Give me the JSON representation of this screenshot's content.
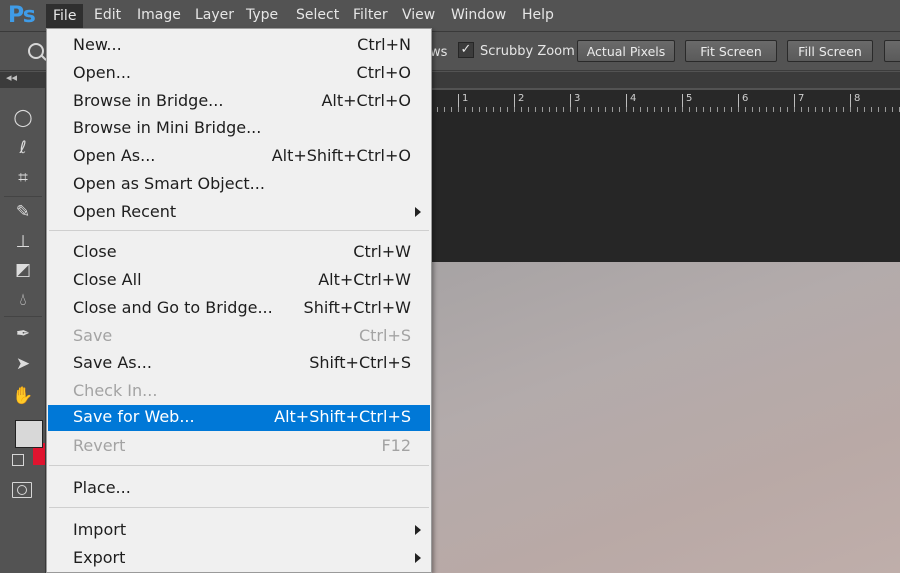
{
  "app_logo": "Ps",
  "menubar": [
    "File",
    "Edit",
    "Image",
    "Layer",
    "Type",
    "Select",
    "Filter",
    "View",
    "Window",
    "Help"
  ],
  "options_bar": {
    "partial_label": "ws",
    "scrubby_zoom_checked": true,
    "scrubby_zoom_label": "Scrubby Zoom",
    "buttons": [
      "Actual Pixels",
      "Fit Screen",
      "Fill Screen"
    ]
  },
  "ruler_numbers": [
    "1",
    "2",
    "3",
    "4",
    "5",
    "6",
    "7",
    "8"
  ],
  "panel_collapse": "◂◂",
  "colors": {
    "foreground": "#d8d8d8",
    "background": "#e0142f",
    "highlight": "#0078d7",
    "logo": "#3f9ce8"
  },
  "file_menu": {
    "items": [
      {
        "label": "New...",
        "shortcut": "Ctrl+N"
      },
      {
        "label": "Open...",
        "shortcut": "Ctrl+O"
      },
      {
        "label": "Browse in Bridge...",
        "shortcut": "Alt+Ctrl+O"
      },
      {
        "label": "Browse in Mini Bridge...",
        "shortcut": ""
      },
      {
        "label": "Open As...",
        "shortcut": "Alt+Shift+Ctrl+O"
      },
      {
        "label": "Open as Smart Object...",
        "shortcut": ""
      },
      {
        "label": "Open Recent",
        "shortcut": "",
        "submenu": true
      },
      {
        "label": "Close",
        "shortcut": "Ctrl+W"
      },
      {
        "label": "Close All",
        "shortcut": "Alt+Ctrl+W"
      },
      {
        "label": "Close and Go to Bridge...",
        "shortcut": "Shift+Ctrl+W"
      },
      {
        "label": "Save",
        "shortcut": "Ctrl+S",
        "disabled": true
      },
      {
        "label": "Save As...",
        "shortcut": "Shift+Ctrl+S"
      },
      {
        "label": "Check In...",
        "shortcut": "",
        "disabled": true
      },
      {
        "label": "Save for Web...",
        "shortcut": "Alt+Shift+Ctrl+S",
        "highlighted": true
      },
      {
        "label": "Revert",
        "shortcut": "F12",
        "disabled": true
      },
      {
        "label": "Place...",
        "shortcut": ""
      },
      {
        "label": "Import",
        "shortcut": "",
        "submenu": true
      },
      {
        "label": "Export",
        "shortcut": "",
        "submenu": true
      }
    ]
  },
  "tool_icons": [
    "elliptical-marquee-icon",
    "lasso-icon",
    "crop-icon",
    "healing-brush-icon",
    "clone-stamp-icon",
    "eraser-icon",
    "blur-drop-icon",
    "pen-icon",
    "path-selection-icon",
    "hand-icon"
  ]
}
